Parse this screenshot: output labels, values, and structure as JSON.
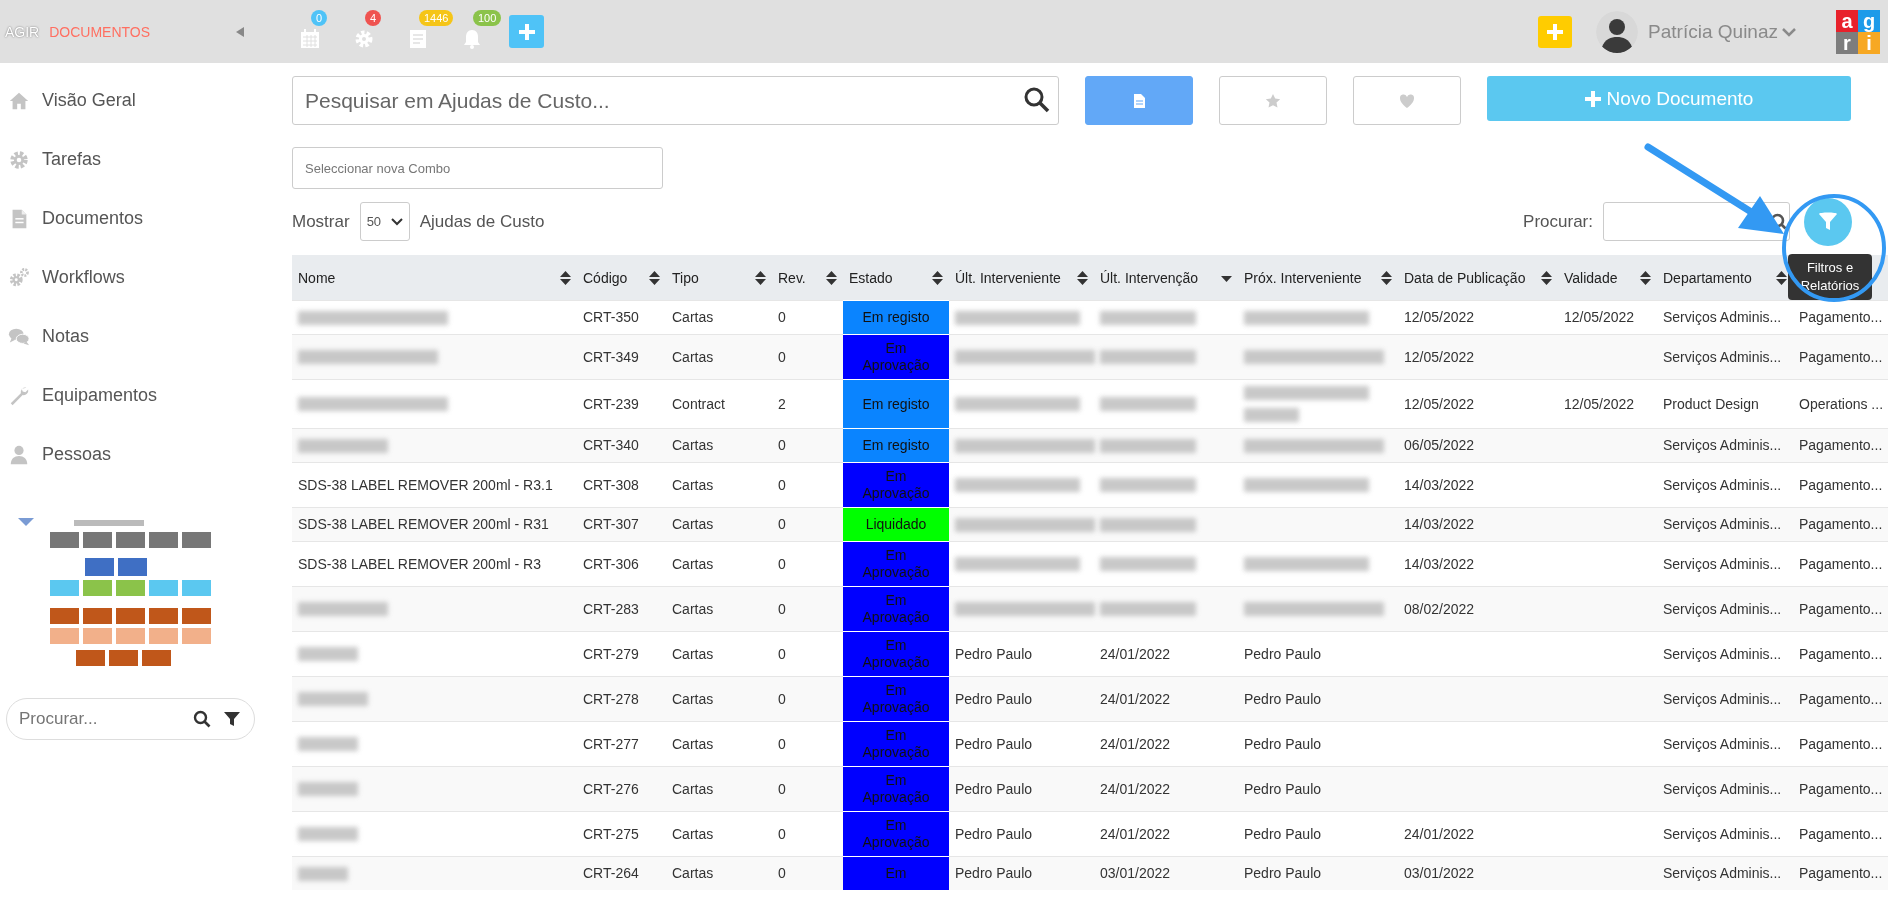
{
  "topbar": {
    "app": "AGIR",
    "section": "DOCUMENTOS",
    "icons": [
      {
        "kind": "calendar",
        "count": "0",
        "color": "#4fc3f7"
      },
      {
        "kind": "gear",
        "count": "4",
        "color": "#ef5350"
      },
      {
        "kind": "document",
        "count": "1446",
        "color": "#f5c518"
      },
      {
        "kind": "bell",
        "count": "100",
        "color": "#8bc34a"
      }
    ],
    "user": "Patrícia Quinaz",
    "logo": [
      {
        "letter": "a",
        "color": "#e8212b"
      },
      {
        "letter": "g",
        "color": "#1e9be9"
      },
      {
        "letter": "r",
        "color": "#7d7d7d"
      },
      {
        "letter": "i",
        "color": "#f7a823"
      }
    ]
  },
  "sidebar": {
    "items": [
      {
        "kind": "home",
        "label": "Visão Geral"
      },
      {
        "kind": "gear",
        "label": "Tarefas"
      },
      {
        "kind": "document",
        "label": "Documentos"
      },
      {
        "kind": "gears",
        "label": "Workflows"
      },
      {
        "kind": "chat",
        "label": "Notas"
      },
      {
        "kind": "wrench",
        "label": "Equipamentos"
      },
      {
        "kind": "person",
        "label": "Pessoas"
      }
    ],
    "search": {
      "placeholder": "Procurar..."
    }
  },
  "search": {
    "placeholder": "Pesquisar em Ajudas de Custo..."
  },
  "view_buttons": [
    {
      "kind": "document",
      "selected": true
    },
    {
      "kind": "star",
      "selected": false
    },
    {
      "kind": "heart",
      "selected": false
    }
  ],
  "new_button": "Novo Documento",
  "combo": {
    "placeholder": "Seleccionar nova Combo"
  },
  "length": {
    "before": "Mostrar",
    "value": "50",
    "after": "Ajudas de Custo"
  },
  "filter": {
    "label": "Procurar:",
    "tooltip": "Filtros e Relatórios"
  },
  "annotation": {
    "arrow": true,
    "circle": true
  },
  "table": {
    "columns": [
      {
        "label": "Nome",
        "kind": "sortable"
      },
      {
        "label": "Código",
        "kind": "sortable"
      },
      {
        "label": "Tipo",
        "kind": "sortable"
      },
      {
        "label": "Rev.",
        "kind": "sortable"
      },
      {
        "label": "Estado",
        "kind": "sortable"
      },
      {
        "label": "Últ. Interveniente",
        "kind": "sortable"
      },
      {
        "label": "Últ. Intervenção",
        "kind": "sorted_desc"
      },
      {
        "label": "Próx. Interveniente",
        "kind": "sortable"
      },
      {
        "label": "Data de Publicação",
        "kind": "sortable"
      },
      {
        "label": "Validade",
        "kind": "sortable"
      },
      {
        "label": "Departamento",
        "kind": "sortable"
      },
      {
        "kind": "sortable"
      }
    ],
    "rows": [
      {
        "cells": [
          {
            "blurred": true
          },
          "CRT-350",
          "Cartas",
          "0",
          {
            "label": "Em registo",
            "color": "#0a84ff"
          },
          {
            "blurred": true
          },
          {
            "blurred": true
          },
          {
            "blurred": true
          },
          "12/05/2022",
          "12/05/2022",
          "Serviços Adminis...",
          "Pagamento..."
        ]
      },
      {
        "cells": [
          {
            "blurred": true
          },
          "CRT-349",
          "Cartas",
          "0",
          {
            "label": "Em Aprovação",
            "color": "#0000ff"
          },
          {
            "blurred": true
          },
          {
            "blurred": true
          },
          {
            "blurred": true
          },
          "12/05/2022",
          null,
          "Serviços Adminis...",
          "Pagamento..."
        ]
      },
      {
        "cells": [
          {
            "blurred": true
          },
          "CRT-239",
          "Contract",
          "2",
          {
            "label": "Em registo",
            "color": "#0a84ff"
          },
          {
            "blurred": true
          },
          {
            "blurred": true
          },
          {
            "blurred": true,
            "wrapped": true
          },
          "12/05/2022",
          "12/05/2022",
          "Product Design",
          "Operations ..."
        ]
      },
      {
        "cells": [
          {
            "blurred": true
          },
          "CRT-340",
          "Cartas",
          "0",
          {
            "label": "Em registo",
            "color": "#0a84ff"
          },
          {
            "blurred": true
          },
          {
            "blurred": true
          },
          {
            "blurred": true
          },
          "06/05/2022",
          null,
          "Serviços Adminis...",
          "Pagamento..."
        ]
      },
      {
        "cells": [
          "SDS-38 LABEL REMOVER 200ml - R3.1",
          "CRT-308",
          "Cartas",
          "0",
          {
            "label": "Em Aprovação",
            "color": "#0000ff"
          },
          {
            "blurred": true
          },
          {
            "blurred": true
          },
          {
            "blurred": true
          },
          "14/03/2022",
          null,
          "Serviços Adminis...",
          "Pagamento..."
        ]
      },
      {
        "cells": [
          "SDS-38 LABEL REMOVER 200ml - R31",
          "CRT-307",
          "Cartas",
          "0",
          {
            "label": "Liquidado",
            "color": "#00ff00"
          },
          {
            "blurred": true
          },
          {
            "blurred": true
          },
          null,
          "14/03/2022",
          null,
          "Serviços Adminis...",
          "Pagamento..."
        ]
      },
      {
        "cells": [
          "SDS-38 LABEL REMOVER 200ml - R3",
          "CRT-306",
          "Cartas",
          "0",
          {
            "label": "Em Aprovação",
            "color": "#0000ff"
          },
          {
            "blurred": true
          },
          {
            "blurred": true
          },
          {
            "blurred": true
          },
          "14/03/2022",
          null,
          "Serviços Adminis...",
          "Pagamento..."
        ]
      },
      {
        "cells": [
          {
            "blurred": true
          },
          "CRT-283",
          "Cartas",
          "0",
          {
            "label": "Em Aprovação",
            "color": "#0000ff"
          },
          {
            "blurred": true
          },
          {
            "blurred": true
          },
          {
            "blurred": true
          },
          "08/02/2022",
          null,
          "Serviços Adminis...",
          "Pagamento..."
        ]
      },
      {
        "cells": [
          {
            "blurred": true
          },
          "CRT-279",
          "Cartas",
          "0",
          {
            "label": "Em Aprovação",
            "color": "#0000ff"
          },
          "Pedro Paulo",
          "24/01/2022",
          "Pedro Paulo",
          null,
          null,
          "Serviços Adminis...",
          "Pagamento..."
        ]
      },
      {
        "cells": [
          {
            "blurred": true
          },
          "CRT-278",
          "Cartas",
          "0",
          {
            "label": "Em Aprovação",
            "color": "#0000ff"
          },
          "Pedro Paulo",
          "24/01/2022",
          "Pedro Paulo",
          null,
          null,
          "Serviços Adminis...",
          "Pagamento..."
        ]
      },
      {
        "cells": [
          {
            "blurred": true
          },
          "CRT-277",
          "Cartas",
          "0",
          {
            "label": "Em Aprovação",
            "color": "#0000ff"
          },
          "Pedro Paulo",
          "24/01/2022",
          "Pedro Paulo",
          null,
          null,
          "Serviços Adminis...",
          "Pagamento..."
        ]
      },
      {
        "cells": [
          {
            "blurred": true
          },
          "CRT-276",
          "Cartas",
          "0",
          {
            "label": "Em Aprovação",
            "color": "#0000ff"
          },
          "Pedro Paulo",
          "24/01/2022",
          "Pedro Paulo",
          null,
          null,
          "Serviços Adminis...",
          "Pagamento..."
        ]
      },
      {
        "cells": [
          {
            "blurred": true
          },
          "CRT-275",
          "Cartas",
          "0",
          {
            "label": "Em Aprovação",
            "color": "#0000ff"
          },
          "Pedro Paulo",
          "24/01/2022",
          "Pedro Paulo",
          "24/01/2022",
          null,
          "Serviços Adminis...",
          "Pagamento..."
        ]
      },
      {
        "cells": [
          {
            "blurred": true
          },
          "CRT-264",
          "Cartas",
          "0",
          {
            "label": "Em",
            "color": "#0000ff"
          },
          "Pedro Paulo",
          "03/01/2022",
          "Pedro Paulo",
          "03/01/2022",
          null,
          "Serviços Adminis...",
          "Pagamento..."
        ]
      }
    ]
  }
}
